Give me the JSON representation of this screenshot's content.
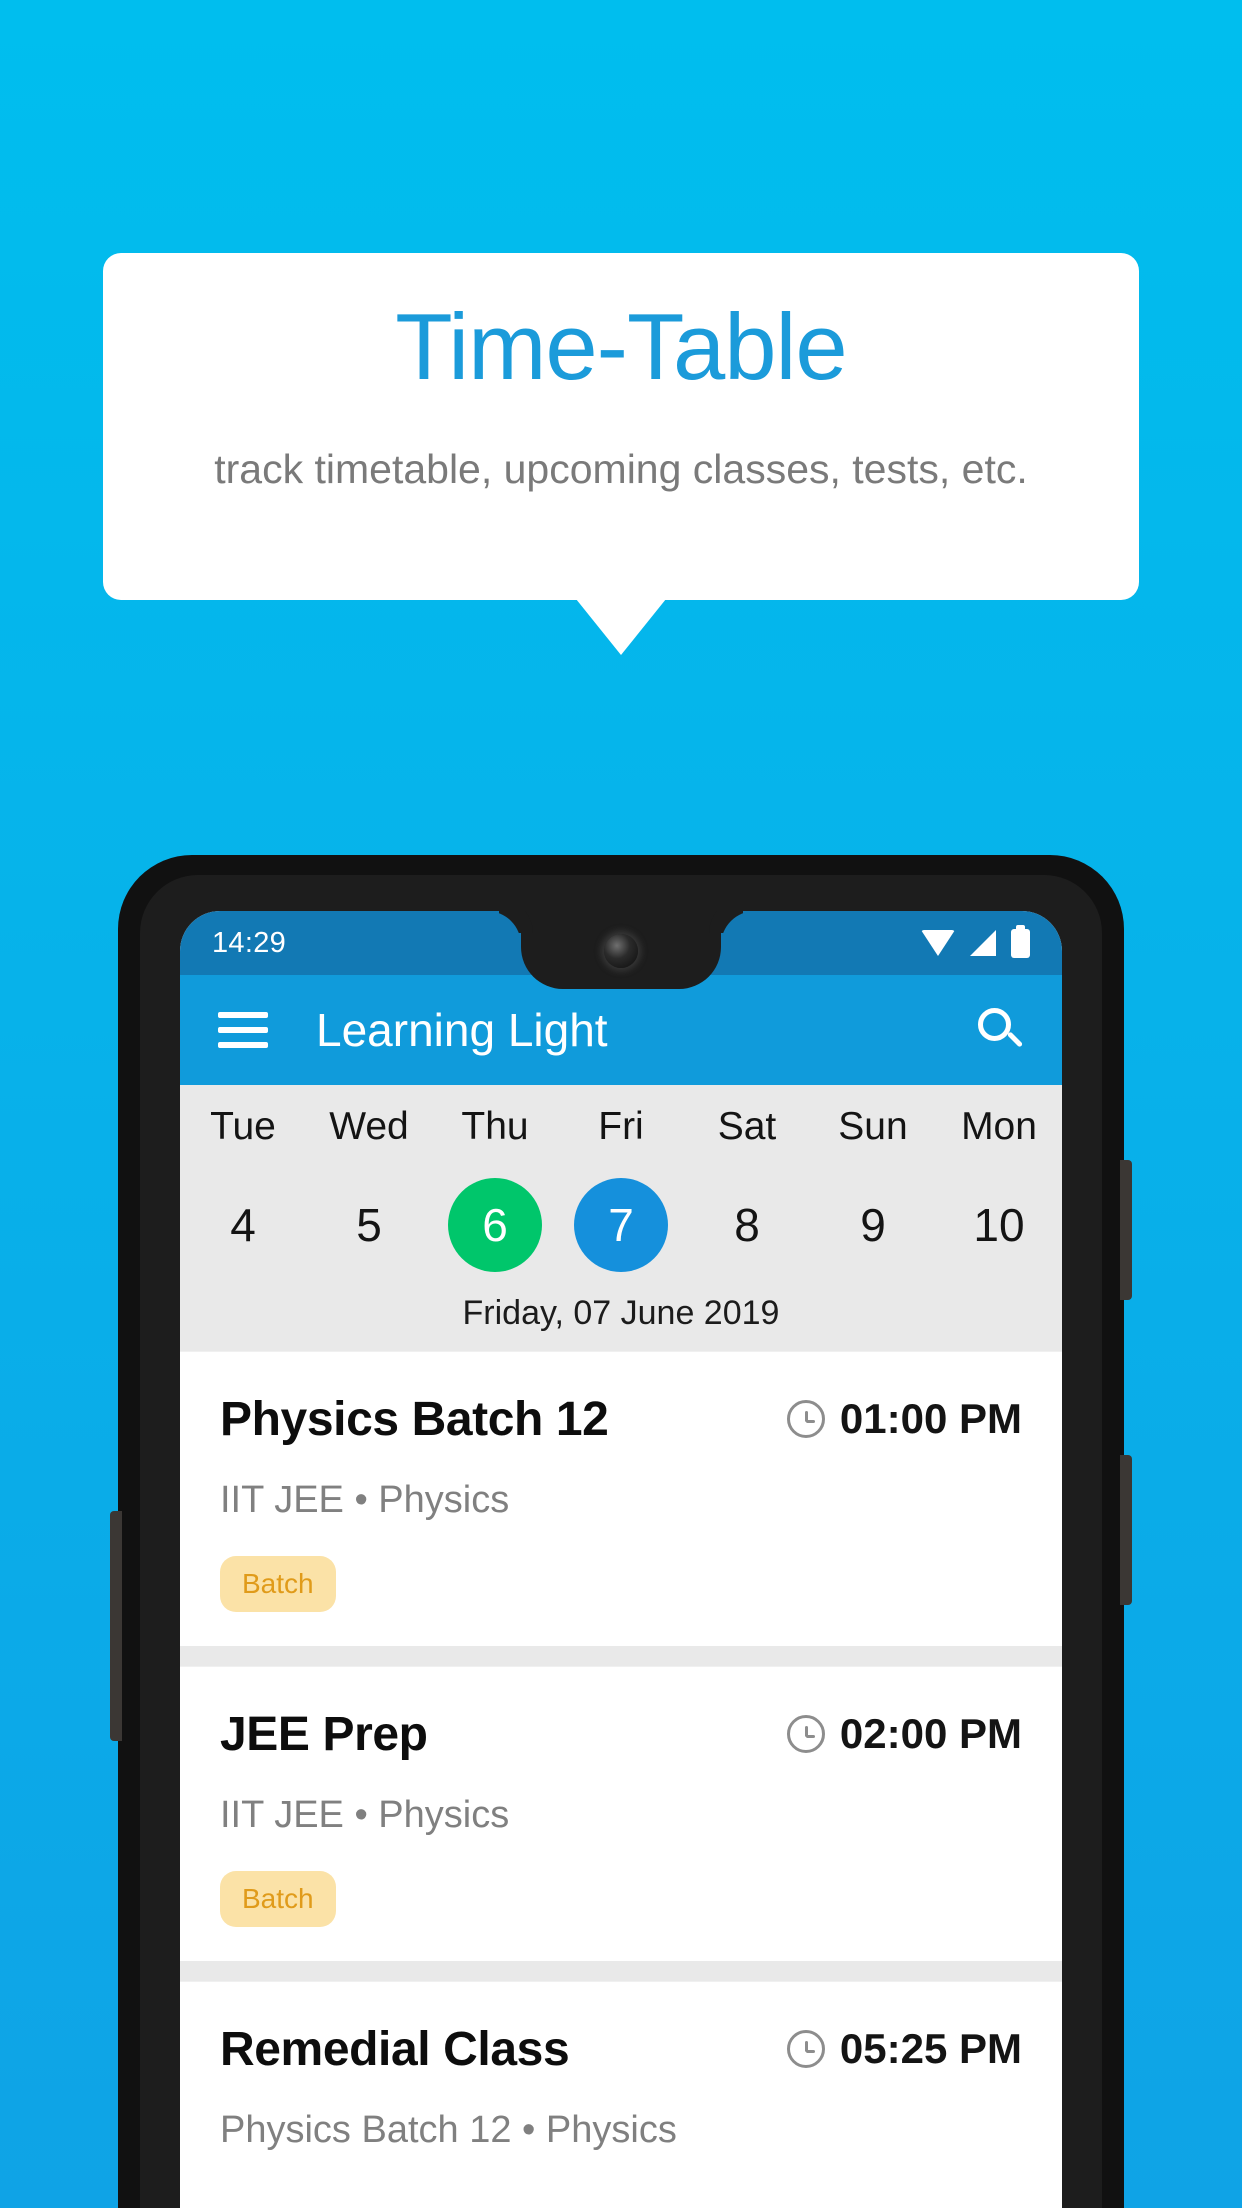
{
  "promo": {
    "title": "Time-Table",
    "subtitle": "track timetable, upcoming classes, tests, etc.",
    "title_color": "#1B9BDA",
    "background_top": "#00BEEE",
    "background_bottom": "#0FA3E6"
  },
  "phone": {
    "statusbar": {
      "time": "14:29",
      "icons": [
        "wifi-icon",
        "signal-icon",
        "battery-icon"
      ],
      "background": "#1279B4"
    },
    "appbar": {
      "menu_icon": "hamburger-menu-icon",
      "title": "Learning Light",
      "search_icon": "search-icon",
      "background": "#109BDB"
    },
    "daystrip": {
      "days": [
        {
          "name": "Tue",
          "num": "4",
          "state": "normal"
        },
        {
          "name": "Wed",
          "num": "5",
          "state": "normal"
        },
        {
          "name": "Thu",
          "num": "6",
          "state": "today"
        },
        {
          "name": "Fri",
          "num": "7",
          "state": "selected"
        },
        {
          "name": "Sat",
          "num": "8",
          "state": "normal"
        },
        {
          "name": "Sun",
          "num": "9",
          "state": "normal"
        },
        {
          "name": "Mon",
          "num": "10",
          "state": "normal"
        }
      ],
      "full_date": "Friday, 07 June 2019",
      "today_color": "#00C66B",
      "selected_color": "#1590DC"
    },
    "classes": [
      {
        "title": "Physics Batch 12",
        "time": "01:00 PM",
        "subtitle": "IIT JEE • Physics",
        "badge": "Batch"
      },
      {
        "title": "JEE Prep",
        "time": "02:00 PM",
        "subtitle": "IIT JEE • Physics",
        "badge": "Batch"
      },
      {
        "title": "Remedial Class",
        "time": "05:25 PM",
        "subtitle": "Physics Batch 12 • Physics",
        "badge": ""
      }
    ],
    "badge_bg": "#FBE2A7",
    "badge_text_color": "#E09B1A"
  }
}
